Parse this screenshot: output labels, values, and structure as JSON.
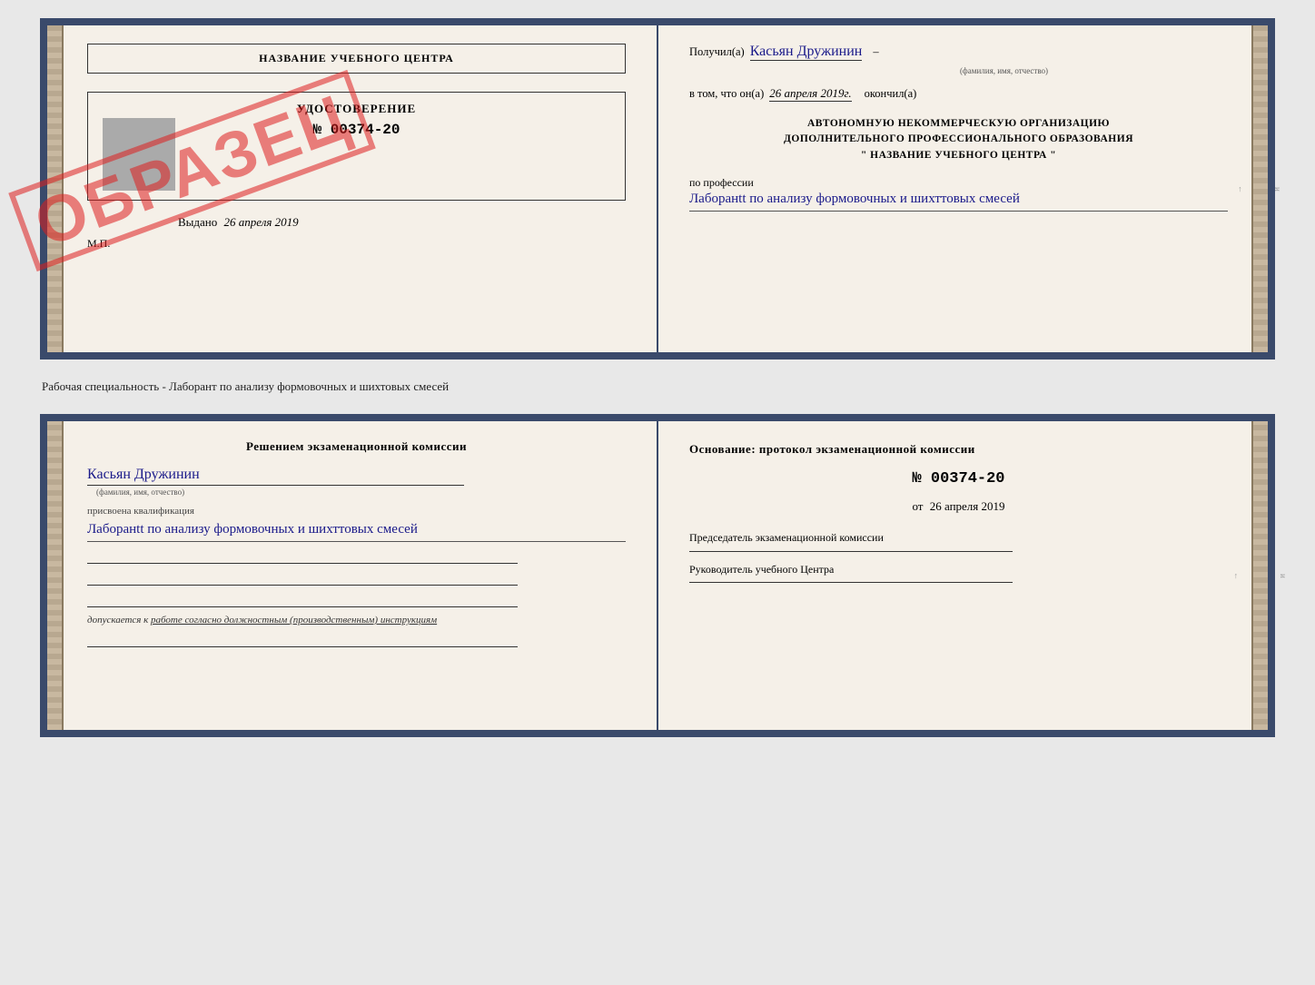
{
  "top_document": {
    "left": {
      "school_name": "НАЗВАНИЕ УЧЕБНОГО ЦЕНТРА",
      "cert_title": "УДОСТОВЕРЕНИЕ",
      "cert_number": "№ 00374-20",
      "issued_label": "Выдано",
      "issued_date": "26 апреля 2019",
      "mp_label": "М.П.",
      "stamp_text": "ОБРАЗЕЦ"
    },
    "right": {
      "received_prefix": "Получил(а)",
      "received_name": "Касьян Дружинин",
      "name_sublabel": "(фамилия, имя, отчество)",
      "in_that_prefix": "в том, что он(а)",
      "finished_date": "26 апреля 2019г.",
      "finished_label": "окончил(а)",
      "org_line1": "АВТОНОМНУЮ НЕКОММЕРЧЕСКУЮ ОРГАНИЗАЦИЮ",
      "org_line2": "ДОПОЛНИТЕЛЬНОГО ПРОФЕССИОНАЛЬНОГО ОБРАЗОВАНИЯ",
      "org_line3": "\" НАЗВАНИЕ УЧЕБНОГО ЦЕНТРА \"",
      "profession_label": "по профессии",
      "profession_handwritten": "Лаборанtt по анализу формовочных и шихттовых смесей"
    }
  },
  "middle_text": "Рабочая специальность - Лаборант по анализу формовочных и шихтовых смесей",
  "bottom_document": {
    "left": {
      "commission_title": "Решением экзаменационной комиссии",
      "name_handwritten": "Касьян Дружинин",
      "name_sublabel": "(фамилия, имя, отчество)",
      "qualification_label": "присвоена квалификация",
      "qualification_handwritten": "Лаборанtt по анализу формовочных и шихттовых смесей",
      "допускается_label": "допускается к",
      "допускается_text": "работе согласно должностным (производственным) инструкциям"
    },
    "right": {
      "basis_label": "Основание: протокол экзаменационной комиссии",
      "protocol_number": "№ 00374-20",
      "from_prefix": "от",
      "from_date": "26 апреля 2019",
      "chairman_label": "Председатель экзаменационной комиссии",
      "director_label": "Руководитель учебного Центра"
    }
  }
}
